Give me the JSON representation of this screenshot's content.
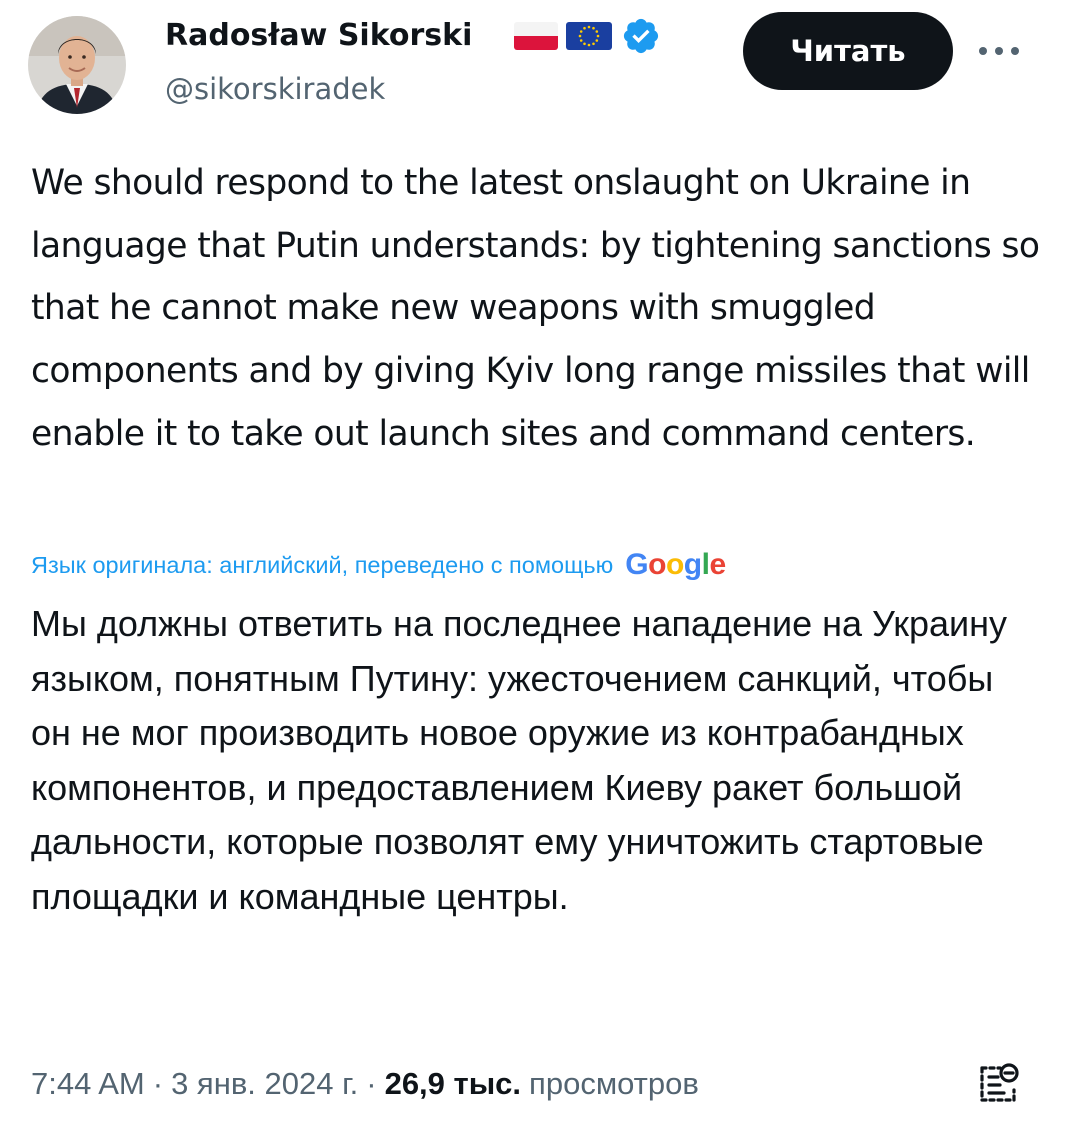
{
  "author": {
    "name": "Radosław Sikorski",
    "handle": "@sikorskiradek",
    "avatar_icon": "profile-photo",
    "badges": [
      "flag-poland-icon",
      "flag-eu-icon",
      "verified-badge-icon"
    ]
  },
  "actions": {
    "follow_label": "Читать",
    "more_icon": "more-dots-icon"
  },
  "tweet": {
    "text": "We should respond to the latest onslaught on Ukraine in language that Putin understands: by tightening sanctions so that he cannot make new weapons with smuggled components and by giving Kyiv long range missiles that will enable it to take out launch sites and command centers.",
    "translation_note": "Язык оригинала: английский, переведено с помощью",
    "translation_provider": "Google",
    "translated_text": "Мы должны ответить на последнее нападение на Украину языком, понятным Путину: ужесточением санкций, чтобы он не мог производить новое оружие из контрабандных компонентов, и предоставлением Киеву ракет большой дальности, которые позволят ему уничтожить стартовые площадки и командные центры."
  },
  "meta": {
    "time": "7:44 AM",
    "date": "3 янв. 2024 г.",
    "separator": "·",
    "views_count": "26,9 тыс.",
    "views_label": "просмотров",
    "summary_icon": "post-summary-icon"
  },
  "colors": {
    "text": "#0f1419",
    "secondary": "#536471",
    "link": "#1d9bf0",
    "button_bg": "#0f1419",
    "button_text": "#ffffff",
    "verified": "#1d9bf0"
  }
}
